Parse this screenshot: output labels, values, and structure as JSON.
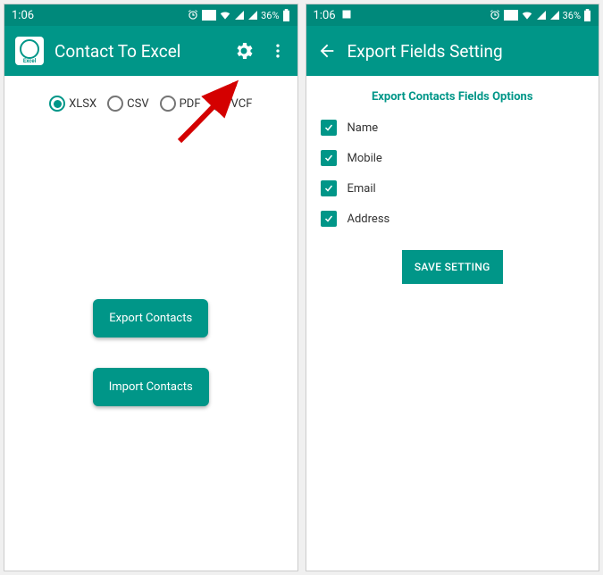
{
  "status": {
    "time": "1:06",
    "battery": "36%"
  },
  "left_screen": {
    "app_title": "Contact To Excel",
    "formats": [
      {
        "label": "XLSX",
        "checked": true
      },
      {
        "label": "CSV",
        "checked": false
      },
      {
        "label": "PDF",
        "checked": false
      },
      {
        "label": "VCF",
        "checked": false
      }
    ],
    "export_btn": "Export Contacts",
    "import_btn": "Import Contacts"
  },
  "right_screen": {
    "app_title": "Export Fields Setting",
    "section_title": "Export Contacts Fields Options",
    "fields": [
      {
        "label": "Name",
        "checked": true
      },
      {
        "label": "Mobile",
        "checked": true
      },
      {
        "label": "Email",
        "checked": true
      },
      {
        "label": "Address",
        "checked": true
      }
    ],
    "save_btn": "SAVE SETTING"
  }
}
